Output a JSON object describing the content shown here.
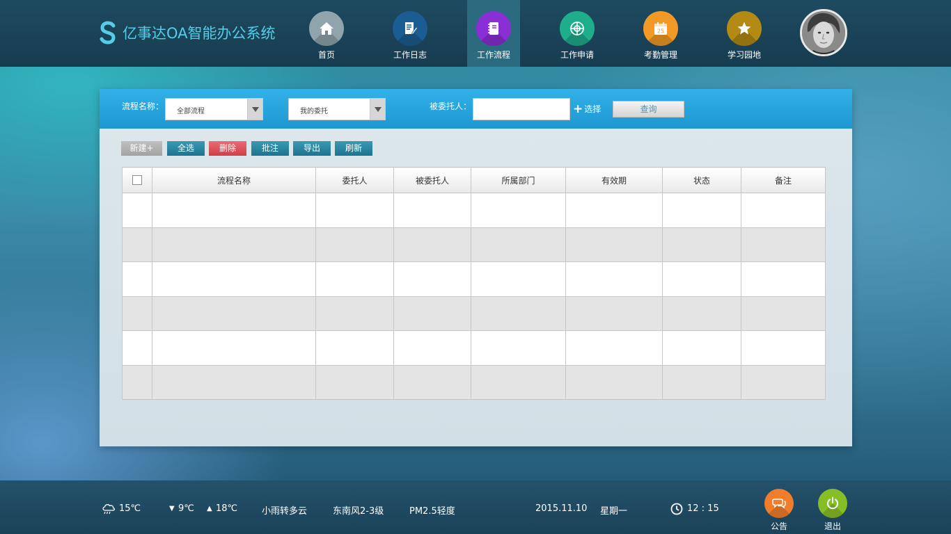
{
  "app": {
    "title": "亿事达OA智能办公系统",
    "logo_letter": "S",
    "accent": "#53cde8"
  },
  "nav": [
    {
      "label": "首页",
      "icon": "home-icon",
      "color": "#8fa4ad"
    },
    {
      "label": "工作日志",
      "icon": "journal-icon",
      "color": "#1b5d93"
    },
    {
      "label": "工作流程",
      "icon": "notebook-icon",
      "color": "#8a2fd6",
      "active": true
    },
    {
      "label": "工作申请",
      "icon": "globe-icon",
      "color": "#1fae8c"
    },
    {
      "label": "考勤管理",
      "icon": "calendar-icon",
      "color": "#f39a26",
      "calendar_day": "25"
    },
    {
      "label": "学习园地",
      "icon": "star-icon",
      "color": "#b38a13"
    }
  ],
  "filters": {
    "process_name_label": "流程名称：",
    "process_name_value": "全部流程",
    "delegation_value": "我的委托",
    "delegatee_label": "被委托人：",
    "delegatee_value": "",
    "choose_label": "选择",
    "query_label": "查询"
  },
  "toolbar": {
    "new_label": "新建+",
    "select_all_label": "全选",
    "delete_label": "删除",
    "annotate_label": "批注",
    "export_label": "导出",
    "refresh_label": "刷新"
  },
  "table": {
    "columns": [
      "流程名称",
      "委托人",
      "被委托人",
      "所属部门",
      "有效期",
      "状态",
      "备注"
    ],
    "rows": [
      [
        "",
        "",
        "",
        "",
        "",
        "",
        ""
      ],
      [
        "",
        "",
        "",
        "",
        "",
        "",
        ""
      ],
      [
        "",
        "",
        "",
        "",
        "",
        "",
        ""
      ],
      [
        "",
        "",
        "",
        "",
        "",
        "",
        ""
      ],
      [
        "",
        "",
        "",
        "",
        "",
        "",
        ""
      ],
      [
        "",
        "",
        "",
        "",
        "",
        "",
        ""
      ]
    ]
  },
  "footer": {
    "weather_icon": "rain-cloud-icon",
    "current_temp": "15℃",
    "low_temp": "9℃",
    "high_temp": "18℃",
    "condition": "小雨转多云",
    "wind": "东南风2-3级",
    "air_quality": "PM2.5轻度",
    "date": "2015.11.10",
    "weekday": "星期一",
    "time": "12 : 15",
    "notice_label": "公告",
    "notice_color": "#ef7d2b",
    "logout_label": "退出",
    "logout_color": "#86be27"
  }
}
